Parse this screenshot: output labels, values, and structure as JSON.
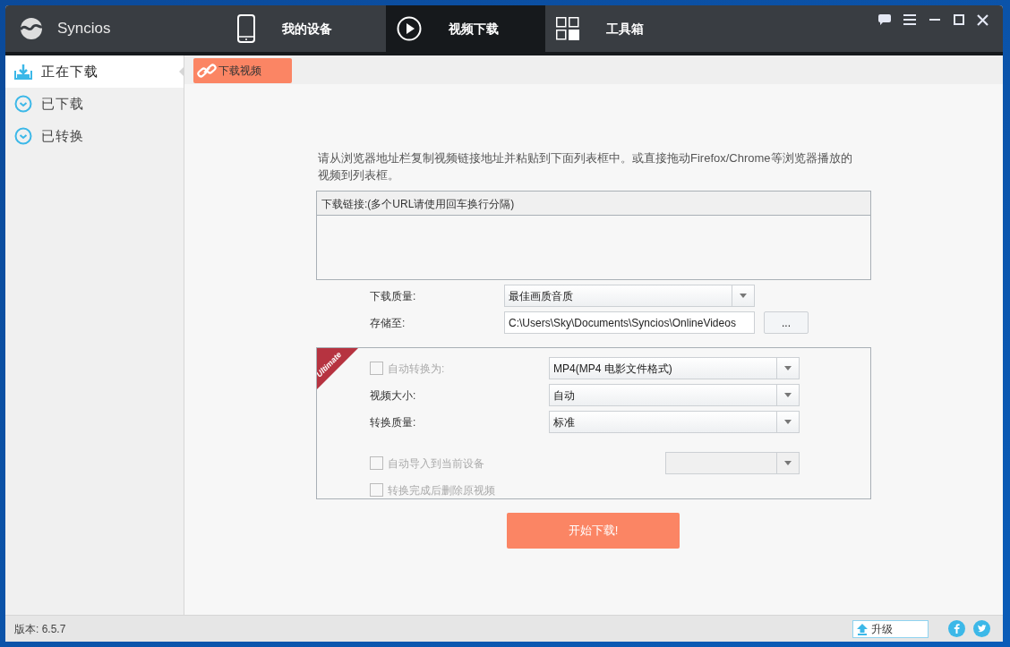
{
  "app": {
    "name": "Syncios"
  },
  "nav_tabs": [
    {
      "label": "我的设备",
      "selected": false,
      "kind": "phone"
    },
    {
      "label": "视频下载",
      "selected": true,
      "kind": "play"
    },
    {
      "label": "工具箱",
      "selected": false,
      "kind": "grid"
    }
  ],
  "sidebar": {
    "items": [
      {
        "label": "正在下载",
        "selected": true,
        "kind": "download"
      },
      {
        "label": "已下载",
        "selected": false,
        "kind": "check"
      },
      {
        "label": "已转换",
        "selected": false,
        "kind": "check"
      }
    ]
  },
  "subtabs": [
    {
      "label": "下载视频",
      "selected": true
    }
  ],
  "instructions": "请从浏览器地址栏复制视频链接地址并粘贴到下面列表框中。或直接拖动Firefox/Chrome等浏览器播放的视频到列表框。",
  "links_box": {
    "header": "下载链接:(多个URL请使用回车换行分隔)"
  },
  "download_quality": {
    "label": "下载质量:",
    "value": "最佳画质音质"
  },
  "save_to": {
    "label": "存储至:",
    "value": "C:\\Users\\Sky\\Documents\\Syncios\\OnlineVideos",
    "button": "..."
  },
  "ultimate": {
    "badge": "Ultimate",
    "options": [
      {
        "kind": "checkbox",
        "label": "自动转换为:",
        "checked": false,
        "disabled": true,
        "select": {
          "value": "MP4(MP4 电影文件格式)",
          "disabled": false
        }
      },
      {
        "kind": "select",
        "label": "视频大小:",
        "select": {
          "value": "自动",
          "disabled": false
        }
      },
      {
        "kind": "select",
        "label": "转换质量:",
        "select": {
          "value": "标准",
          "disabled": false
        }
      },
      {
        "kind": "spacer"
      },
      {
        "kind": "checkbox",
        "label": "自动导入到当前设备",
        "checked": false,
        "disabled": true,
        "select": {
          "disabled": true
        }
      },
      {
        "kind": "checkbox",
        "label": "转换完成后删除原视频",
        "checked": false,
        "disabled": true
      }
    ]
  },
  "start_button": "开始下载!",
  "status_bar": {
    "version": "版本: 6.5.7",
    "upgrade_button": "升级"
  }
}
